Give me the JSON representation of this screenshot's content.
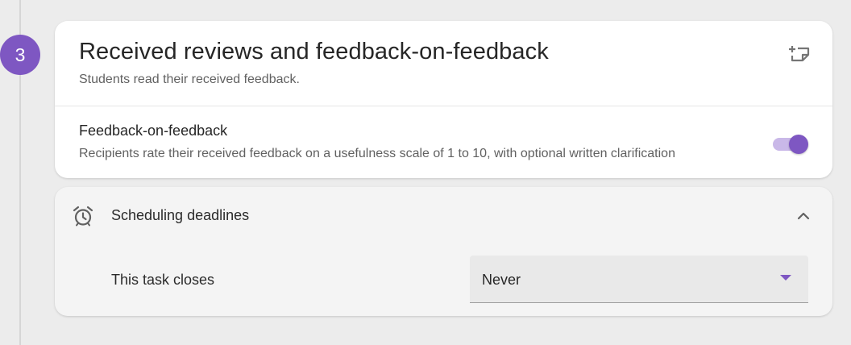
{
  "step": {
    "number": "3"
  },
  "card": {
    "title": "Received reviews and feedback-on-feedback",
    "subtitle": "Students read their received feedback.",
    "action_icon": "add-note-icon",
    "setting": {
      "label": "Feedback-on-feedback",
      "description": "Recipients rate their received feedback on a usefulness scale of 1 to 10, with optional written clarification",
      "enabled": true
    }
  },
  "scheduling": {
    "icon": "alarm-clock-icon",
    "title": "Scheduling deadlines",
    "expanded": true,
    "closes_label": "This task closes",
    "closes_value": "Never"
  },
  "colors": {
    "accent": "#7e57c2",
    "toggle_track": "#c9b8e8",
    "background": "#ececec"
  }
}
